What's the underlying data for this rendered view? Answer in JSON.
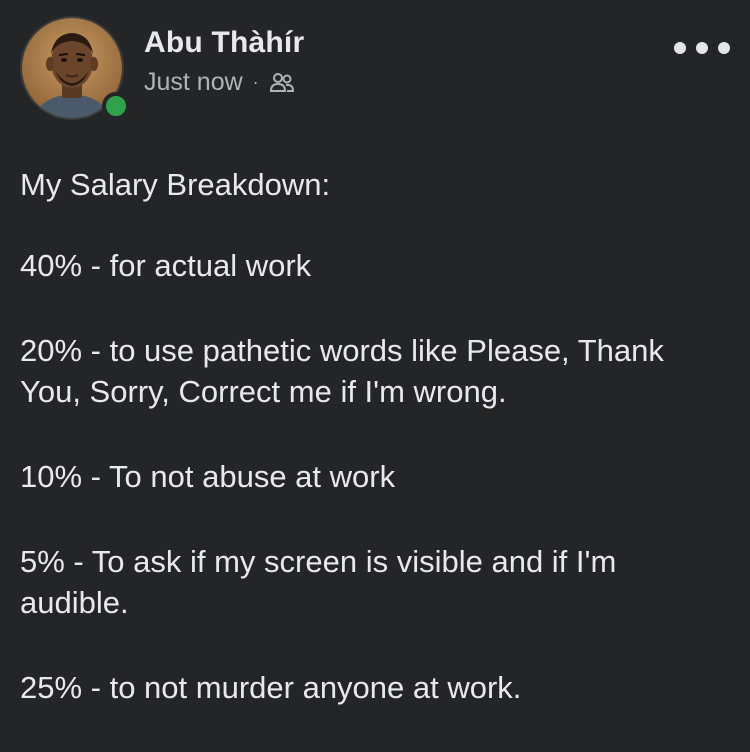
{
  "author": {
    "name": "Abu Thàhír",
    "timestamp": "Just now",
    "separator": "·",
    "audience_icon": "friends-icon",
    "online_status_color": "#31a24c"
  },
  "menu": {
    "icon": "more-options-icon"
  },
  "post": {
    "lines": [
      "My Salary Breakdown:",
      "40% - for actual work",
      "20% - to use pathetic words like Please, Thank You, Sorry, Correct me if I'm wrong.",
      "10% - To not abuse at work",
      "5% - To ask if my screen is visible and if I'm audible.",
      "25% - to not murder anyone at work."
    ]
  },
  "colors": {
    "background": "#242526",
    "text": "#e8e9ed",
    "secondary_text": "#b0b3b8"
  }
}
